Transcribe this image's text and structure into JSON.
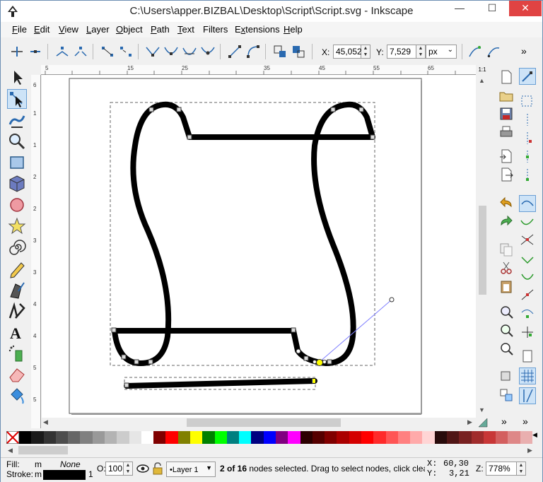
{
  "window": {
    "title": "C:\\Users\\apper.BIZBAL\\Desktop\\Script\\Script.svg - Inkscape",
    "minimize": "—",
    "maximize": "☐",
    "close": "✕"
  },
  "menu": [
    {
      "label": "File",
      "accel": "F",
      "rest": "ile"
    },
    {
      "label": "Edit",
      "accel": "E",
      "rest": "dit"
    },
    {
      "label": "View",
      "accel": "V",
      "rest": "iew"
    },
    {
      "label": "Layer",
      "accel": "L",
      "rest": "ayer"
    },
    {
      "label": "Object",
      "accel": "O",
      "rest": "bject"
    },
    {
      "label": "Path",
      "accel": "P",
      "rest": "ath"
    },
    {
      "label": "Text",
      "accel": "T",
      "rest": "ext"
    },
    {
      "label": "Filters",
      "accel": "",
      "rest": "Filters"
    },
    {
      "label": "Extensions",
      "accel": "x",
      "rest": "tensions"
    },
    {
      "label": "Help",
      "accel": "H",
      "rest": "elp"
    }
  ],
  "toolbar": {
    "x_label": "X:",
    "x_value": "45,052",
    "y_label": "Y:",
    "y_value": "7,529",
    "unit": "px",
    "overflow": "»"
  },
  "rulers": {
    "h_ticks": [
      "5",
      "15",
      "25",
      "35",
      "45",
      "55",
      "65"
    ],
    "v_ticks": [
      "6",
      "1",
      "1",
      "2",
      "2",
      "3",
      "3",
      "4",
      "4",
      "5",
      "5"
    ],
    "corner_label": "1:1"
  },
  "palette": {
    "colors": [
      "#000000",
      "#1a1a1a",
      "#333333",
      "#4d4d4d",
      "#666666",
      "#808080",
      "#999999",
      "#b3b3b3",
      "#cccccc",
      "#e6e6e6",
      "#ffffff",
      "#800000",
      "#ff0000",
      "#808000",
      "#ffff00",
      "#008000",
      "#00ff00",
      "#008080",
      "#00ffff",
      "#000080",
      "#0000ff",
      "#800080",
      "#ff00ff",
      "#2b0000",
      "#550000",
      "#800000",
      "#aa0000",
      "#d40000",
      "#ff0000",
      "#ff2a2a",
      "#ff5555",
      "#ff8080",
      "#ffaaaa",
      "#ffd5d5",
      "#280b0b",
      "#501616",
      "#782121",
      "#a02c2c",
      "#c83737",
      "#d35f5f",
      "#de8787",
      "#e9afaf"
    ]
  },
  "status": {
    "fill_label": "Fill:",
    "fill_value": "m",
    "fill_none": "None",
    "stroke_label": "Stroke:",
    "stroke_value": "m",
    "stroke_width": "1",
    "opacity_label": "O:",
    "opacity_value": "100",
    "layer": "•Layer 1",
    "message_bold": "2 of 16",
    "message_rest": " nodes selected. Drag to select nodes, click clear",
    "cursor_x_label": "X:",
    "cursor_x": "60,30",
    "cursor_y_label": "Y:",
    "cursor_y": "3,21",
    "zoom_label": "Z:",
    "zoom_value": "778%"
  },
  "colors": {
    "accent": "#6a9fd4",
    "selected_node": "#ffff00",
    "handle_line": "#8080ff"
  },
  "icons": {
    "app": "inkscape-logo-icon",
    "selector": "selector-arrow-icon",
    "node_tool": "node-edit-icon"
  }
}
